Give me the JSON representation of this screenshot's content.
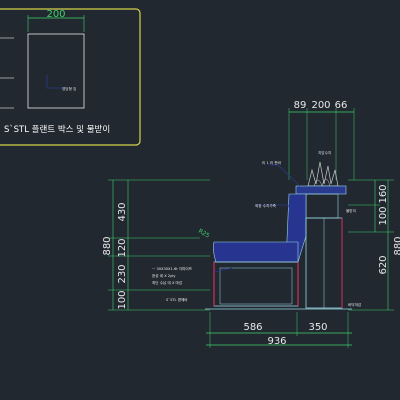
{
  "detail": {
    "width_label": "200",
    "note": "영당형 잉",
    "title": "S`STL 플랜트 박스 및 물받이"
  },
  "section": {
    "top_dims": [
      "89",
      "200",
      "66"
    ],
    "left_dims": [
      "430",
      "120",
      "230",
      "100"
    ],
    "left_total": "880",
    "right_dims": [
      "160",
      "100"
    ],
    "right_total": "620",
    "right_total_upper": "880",
    "bottom_dims": [
      "586",
      "350"
    ],
    "bottom_total": "936",
    "slope_label": "R25",
    "notes": {
      "plant_top": "리 1 리 판바",
      "plant_side": "물받이",
      "back_top": "지압수지",
      "back_label": "외장 수지가죽",
      "back_side": "외장재",
      "base_1": "ㅡ 30X30X1.6t 각파이프",
      "base_2": "완성 데 X 2ply",
      "base_3": "최단 수납 데 X 마감",
      "base_4": "S`STL 편헤바",
      "base_5": "바닥마감"
    }
  },
  "colors": {
    "background": "#212830",
    "frame": "#d6d34a",
    "dimension": "#3fd06a",
    "outline": "#9ad7e4",
    "panel": "#2a3a8f",
    "upholstery": "#283590",
    "accent": "#d0305a",
    "plant": "#c8c8c8"
  }
}
